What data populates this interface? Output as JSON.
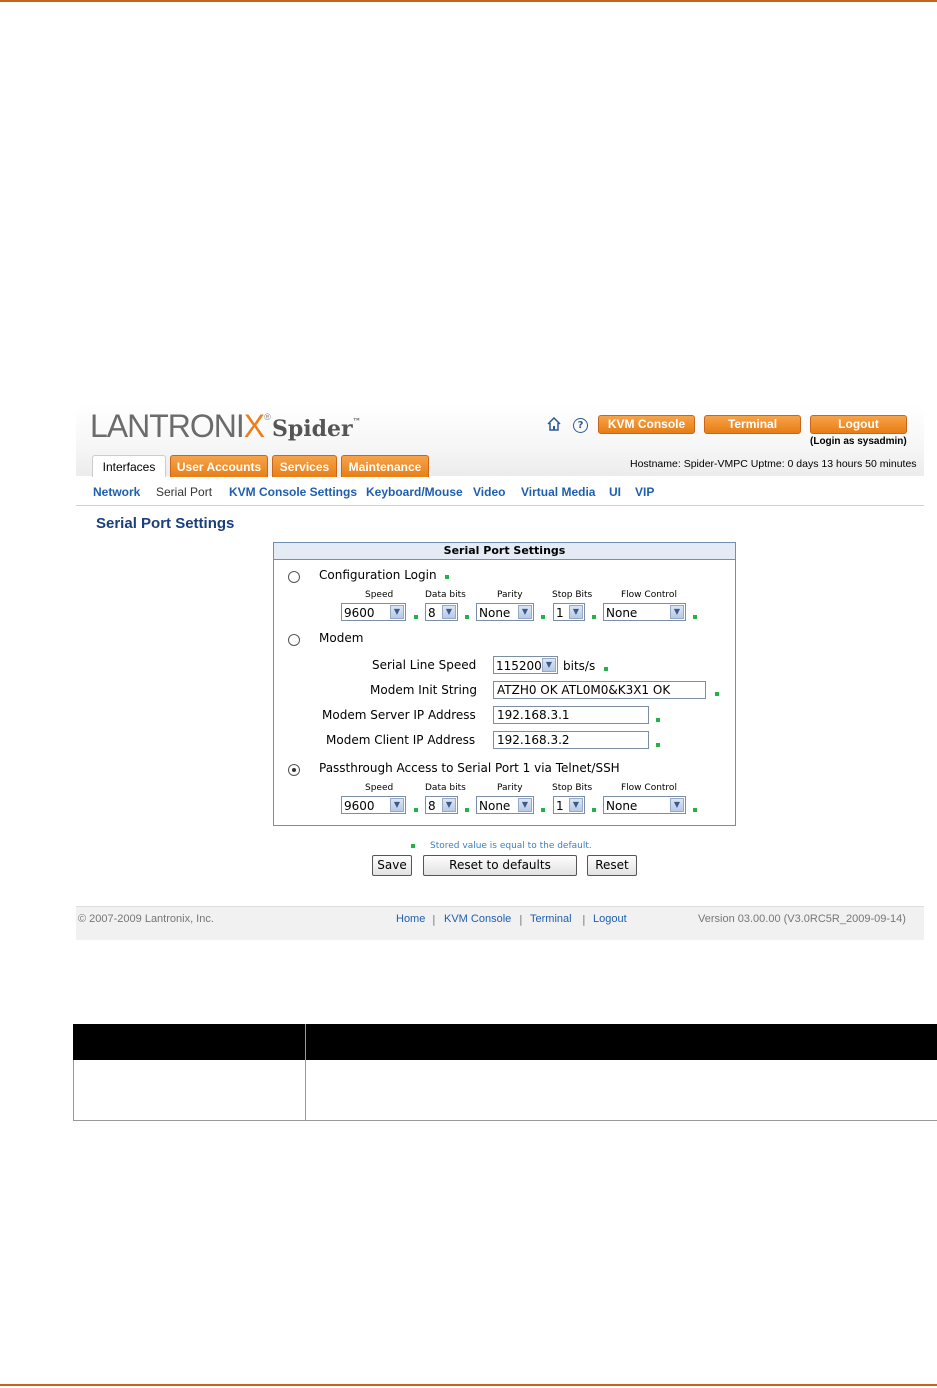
{
  "brand": {
    "logo_text": "LANTRONI",
    "logo_x": "X",
    "logo_reg": "®",
    "product": "Spider",
    "product_tm": "™"
  },
  "header": {
    "kvm_label": "KVM Console",
    "terminal_label": "Terminal",
    "logout_label": "Logout",
    "login_as": "(Login as sysadmin)",
    "host_info": "Hostname: Spider-VMPC    Uptme: 0 days 13 hours 50 minutes"
  },
  "tabs": [
    "Interfaces",
    "User Accounts",
    "Services",
    "Maintenance"
  ],
  "subnav": [
    "Network",
    "Serial Port",
    "KVM Console Settings",
    "Keyboard/Mouse",
    "Video",
    "Virtual Media",
    "UI",
    "VIP"
  ],
  "page_title": "Serial Port Settings",
  "panel": {
    "title": "Serial Port Settings",
    "config_login": {
      "label": "Configuration Login",
      "col_labels": [
        "Speed",
        "Data bits",
        "Parity",
        "Stop Bits",
        "Flow Control"
      ],
      "values": [
        "9600",
        "8",
        "None",
        "1",
        "None"
      ]
    },
    "modem": {
      "label": "Modem",
      "serial_line_speed_label": "Serial Line Speed",
      "serial_line_speed": "115200",
      "bits_unit": "bits/s",
      "init_string_label": "Modem Init String",
      "init_string": "ATZH0 OK ATL0M0&K3X1 OK",
      "server_ip_label": "Modem Server IP Address",
      "server_ip": "192.168.3.1",
      "client_ip_label": "Modem Client IP Address",
      "client_ip": "192.168.3.2"
    },
    "passthrough": {
      "label": "Passthrough Access to Serial Port 1 via Telnet/SSH",
      "col_labels": [
        "Speed",
        "Data bits",
        "Parity",
        "Stop Bits",
        "Flow Control"
      ],
      "values": [
        "9600",
        "8",
        "None",
        "1",
        "None"
      ]
    }
  },
  "legend": "Stored value is equal to the default.",
  "buttons": {
    "save": "Save",
    "reset_defaults": "Reset to defaults",
    "reset": "Reset"
  },
  "footer": {
    "copyright": "© 2007-2009 Lantronix, Inc.",
    "links": [
      "Home",
      "KVM Console",
      "Terminal",
      "Logout"
    ],
    "version": "Version 03.00.00 (V3.0RC5R_2009-09-14)"
  },
  "colors": {
    "accent": "#ee7d1a",
    "link": "#1f5fb0",
    "title": "#1b3f7c",
    "default_marker": "#22b14c"
  }
}
